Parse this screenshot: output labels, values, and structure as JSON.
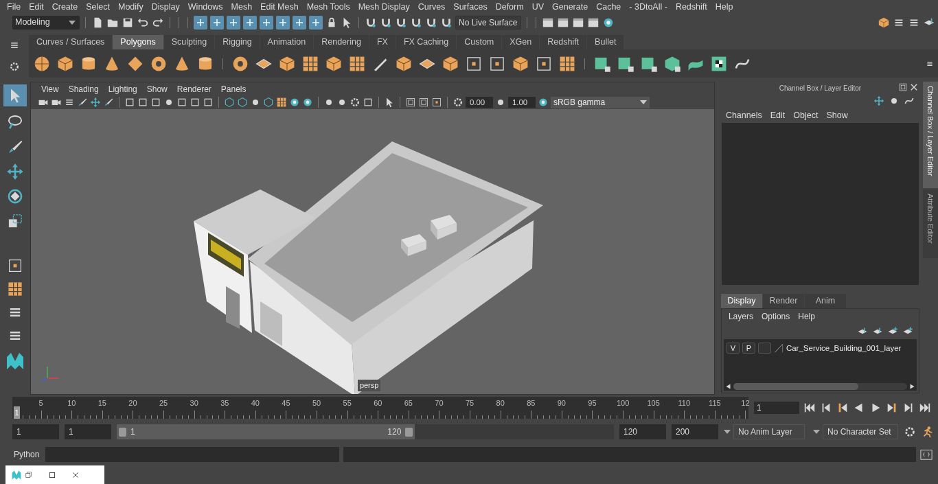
{
  "menu_bar": [
    "File",
    "Edit",
    "Create",
    "Select",
    "Modify",
    "Display",
    "Windows",
    "Mesh",
    "Edit Mesh",
    "Mesh Tools",
    "Mesh Display",
    "Curves",
    "Surfaces",
    "Deform",
    "UV",
    "Generate",
    "Cache",
    "- 3DtoAll -",
    "Redshift",
    "Help"
  ],
  "status_line": {
    "workspace": "Modeling",
    "live_surface": "No Live Surface"
  },
  "shelf_tabs": [
    {
      "label": "Curves / Surfaces",
      "selected": false
    },
    {
      "label": "Polygons",
      "selected": true
    },
    {
      "label": "Sculpting",
      "selected": false
    },
    {
      "label": "Rigging",
      "selected": false
    },
    {
      "label": "Animation",
      "selected": false
    },
    {
      "label": "Rendering",
      "selected": false
    },
    {
      "label": "FX",
      "selected": false
    },
    {
      "label": "FX Caching",
      "selected": false
    },
    {
      "label": "Custom",
      "selected": false
    },
    {
      "label": "XGen",
      "selected": false
    },
    {
      "label": "Redshift",
      "selected": false
    },
    {
      "label": "Bullet",
      "selected": false
    }
  ],
  "viewport": {
    "menus": [
      "View",
      "Shading",
      "Lighting",
      "Show",
      "Renderer",
      "Panels"
    ],
    "exposure": "0.00",
    "gamma": "1.00",
    "color_space": "sRGB gamma",
    "camera_label": "persp"
  },
  "channel_box": {
    "title": "Channel Box / Layer Editor",
    "menus": [
      "Channels",
      "Edit",
      "Object",
      "Show"
    ],
    "layer_tabs": [
      {
        "label": "Display",
        "selected": true
      },
      {
        "label": "Render",
        "selected": false
      },
      {
        "label": "Anim",
        "selected": false
      }
    ],
    "layer_menus": [
      "Layers",
      "Options",
      "Help"
    ],
    "layers": [
      {
        "visibility": "V",
        "playback": "P",
        "name": "Car_Service_Building_001_layer"
      }
    ]
  },
  "side_tabs": [
    {
      "label": "Channel Box / Layer Editor",
      "selected": true
    },
    {
      "label": "Attribute Editor",
      "selected": false
    }
  ],
  "timeline": {
    "ticks": [
      "5",
      "10",
      "15",
      "20",
      "25",
      "30",
      "35",
      "40",
      "45",
      "50",
      "55",
      "60",
      "65",
      "70",
      "75",
      "80",
      "85",
      "90",
      "95",
      "100",
      "105",
      "110",
      "115",
      "12"
    ],
    "current_frame": "1",
    "frame_field": "1",
    "level": 0
  },
  "range": {
    "start": "1",
    "playback_start": "1",
    "slider_start": "1",
    "slider_end": "120",
    "level": 0.6,
    "playback_end": "120",
    "end": "200",
    "anim_layer": "No Anim Layer",
    "character_set": "No Character Set"
  },
  "command_line": {
    "label": "Python"
  }
}
